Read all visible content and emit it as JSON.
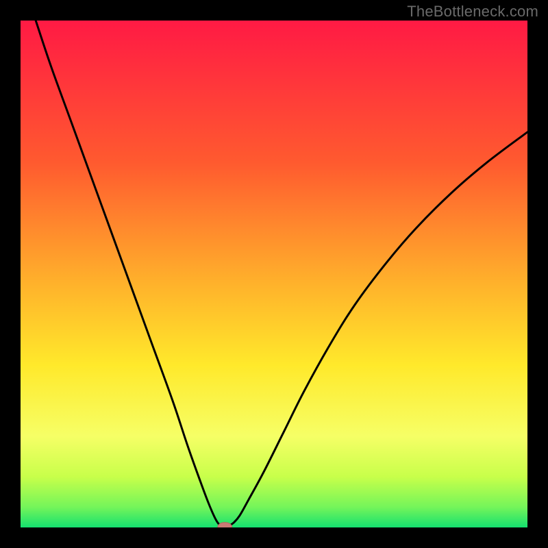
{
  "watermark": "TheBottleneck.com",
  "colors": {
    "bg_outer": "#000000",
    "grad_top": "#ff1a44",
    "grad_mid1": "#ff7a2a",
    "grad_mid2": "#ffd92b",
    "grad_mid3": "#f8ff63",
    "grad_mid4": "#b6ff4a",
    "grad_bottom": "#14e06f",
    "line": "#000000",
    "marker_fill": "#c97a75",
    "marker_stroke": "#b46560"
  },
  "chart_data": {
    "type": "line",
    "title": "",
    "xlabel": "",
    "ylabel": "",
    "xlim": [
      0,
      100
    ],
    "ylim": [
      0,
      100
    ],
    "series": [
      {
        "name": "left-branch",
        "x": [
          3,
          6,
          10,
          14,
          18,
          22,
          26,
          30,
          33,
          35.5,
          37,
          38.2,
          39,
          39.6
        ],
        "y": [
          100,
          91,
          80,
          69,
          58,
          47,
          36,
          25,
          16,
          9,
          5,
          2.2,
          0.8,
          0.4
        ]
      },
      {
        "name": "right-branch",
        "x": [
          41.2,
          42,
          43.2,
          45,
          48,
          52,
          56,
          61,
          66,
          72,
          78,
          85,
          92,
          100
        ],
        "y": [
          0.4,
          0.9,
          2.3,
          5.5,
          11,
          19,
          27,
          36,
          44,
          52,
          59,
          66,
          72,
          78
        ]
      }
    ],
    "marker": {
      "x": 40.3,
      "y": 0.1,
      "rx": 1.4,
      "ry": 0.9
    },
    "gradient_stops": [
      {
        "offset": 0.0,
        "color": "#ff1a44"
      },
      {
        "offset": 0.28,
        "color": "#ff5a2f"
      },
      {
        "offset": 0.52,
        "color": "#ffb22b"
      },
      {
        "offset": 0.68,
        "color": "#ffe92b"
      },
      {
        "offset": 0.82,
        "color": "#f6ff66"
      },
      {
        "offset": 0.9,
        "color": "#c8ff4a"
      },
      {
        "offset": 0.96,
        "color": "#74f55a"
      },
      {
        "offset": 1.0,
        "color": "#14e06f"
      }
    ]
  }
}
